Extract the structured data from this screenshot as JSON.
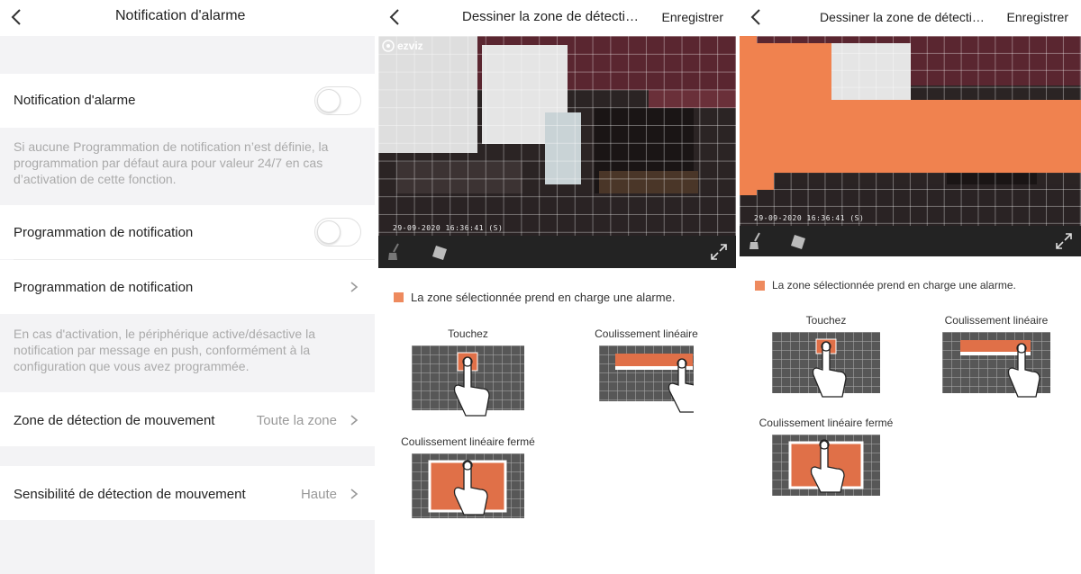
{
  "screen1": {
    "title": "Notification d'alarme",
    "back_icon": "chevron-left-icon",
    "rows": {
      "alarm_notification": {
        "label": "Notification d'alarme",
        "toggle_on": false
      },
      "alarm_note": "Si aucune Programmation de notification n’est définie, la programmation par défaut aura pour valeur 24/7 en cas d’activation de cette fonction.",
      "schedule_toggle": {
        "label": "Programmation de notification",
        "toggle_on": false
      },
      "schedule_link": {
        "label": "Programmation de notification"
      },
      "schedule_note": "En cas d'activation, le périphérique active/désactive la notification par message en push, conformément à la configuration que vous avez programmée.",
      "motion_zone": {
        "label": "Zone de détection de mouvement",
        "value": "Toute la zone"
      },
      "motion_sensitivity": {
        "label": "Sensibilité de détection de mouvement",
        "value": "Haute"
      }
    }
  },
  "screen2": {
    "title": "Dessiner la zone de détecti…",
    "save_label": "Enregistrer",
    "logo_text": "ezviz",
    "timestamp": "29-09-2020 16:36:41  (S)",
    "tools": [
      "broom-icon",
      "eraser-icon",
      "expand-icon"
    ],
    "legend": "La zone sélectionnée prend en charge une alarme.",
    "demos": {
      "tap": "Touchez",
      "linear": "Coulissement linéaire",
      "closed": "Coulissement linéaire fermé"
    }
  },
  "screen3": {
    "title": "Dessiner la zone de détecti…",
    "save_label": "Enregistrer",
    "timestamp": "29-09-2020 16:36:41  (S)",
    "legend": "La zone sélectionnée prend en charge une alarme.",
    "demos": {
      "tap": "Touchez",
      "linear": "Coulissement linéaire",
      "closed": "Coulissement linéaire fermé"
    }
  },
  "colors": {
    "accent_orange": "#ee8a5e",
    "separator_gray": "#f3f3f5",
    "muted_text": "#aaaaaa"
  }
}
